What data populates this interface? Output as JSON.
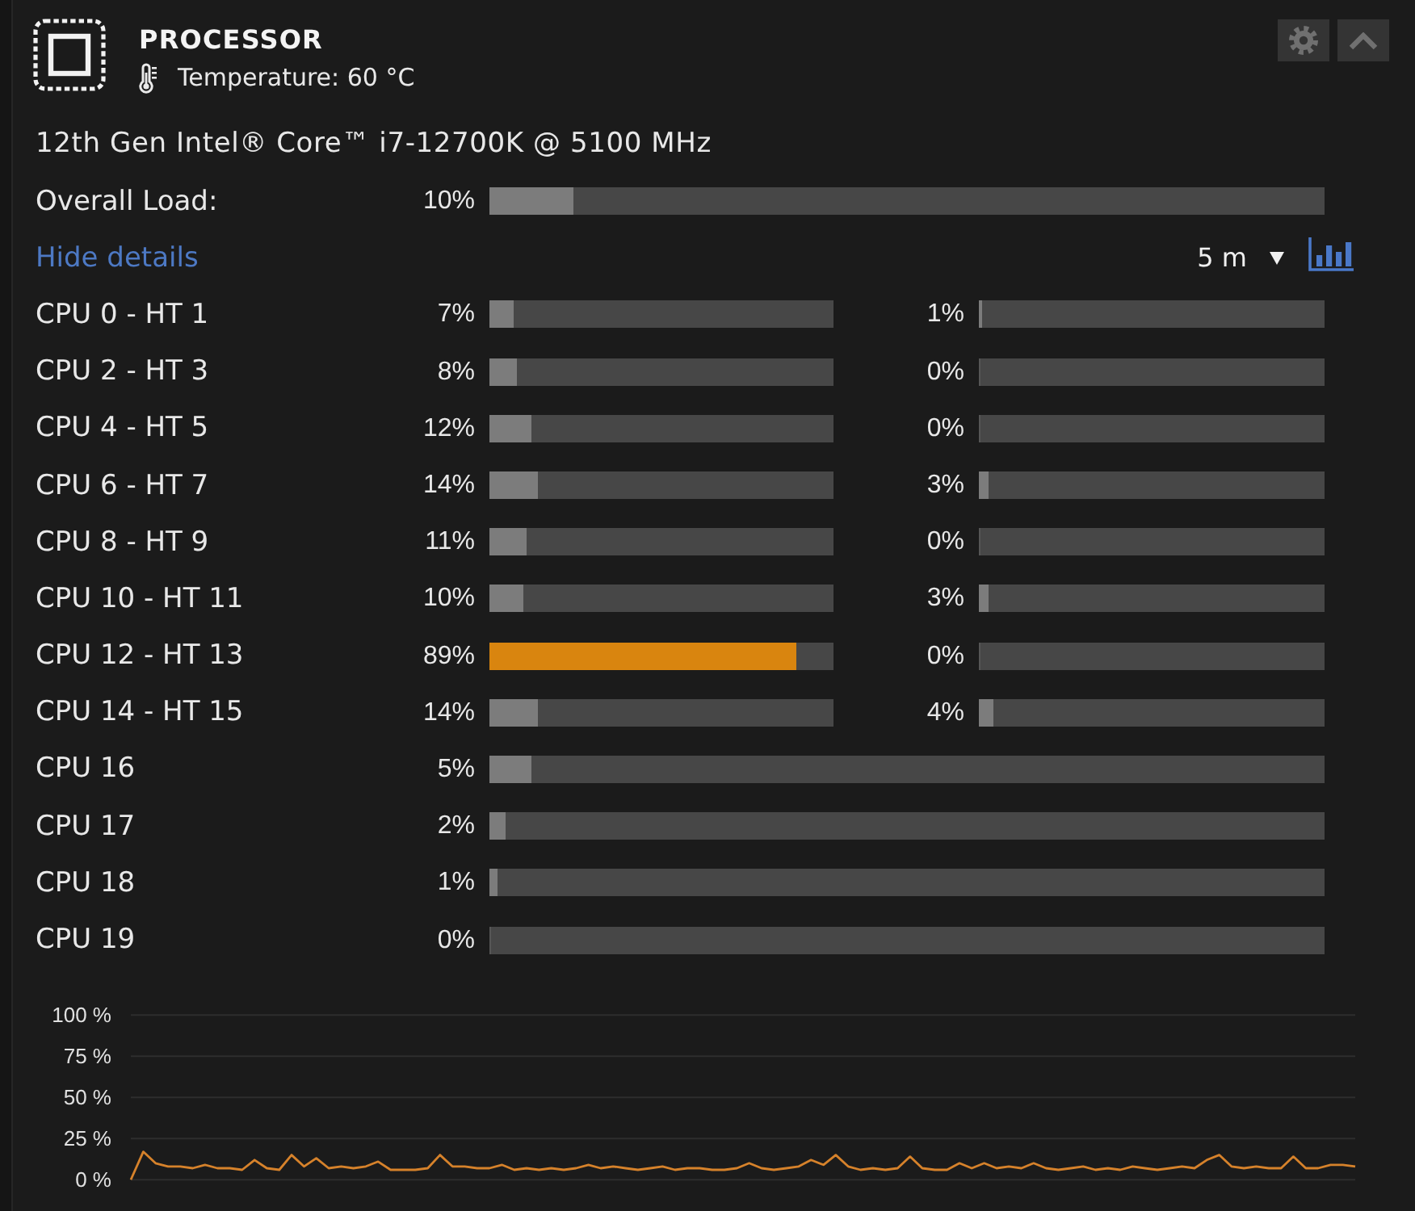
{
  "panel": {
    "title": "PROCESSOR",
    "temperature": "Temperature: 60 °C",
    "model": "12th Gen Intel® Core™ i7-12700K @ 5100 MHz"
  },
  "overall_load": {
    "label": "Overall Load:",
    "reading": "10%",
    "level": 0.1
  },
  "details_link": "Hide details",
  "time_range": {
    "value": "5 m"
  },
  "cores": [
    {
      "kind": "pair",
      "label": "CPU 0 - HT 1",
      "threads": [
        {
          "reading": "7%",
          "level": 0.07
        },
        {
          "reading": "1%",
          "level": 0.01
        }
      ]
    },
    {
      "kind": "pair",
      "label": "CPU 2 - HT 3",
      "threads": [
        {
          "reading": "8%",
          "level": 0.08
        },
        {
          "reading": "0%",
          "level": 0
        }
      ]
    },
    {
      "kind": "pair",
      "label": "CPU 4 - HT 5",
      "threads": [
        {
          "reading": "12%",
          "level": 0.12
        },
        {
          "reading": "0%",
          "level": 0
        }
      ]
    },
    {
      "kind": "pair",
      "label": "CPU 6 - HT 7",
      "threads": [
        {
          "reading": "14%",
          "level": 0.14
        },
        {
          "reading": "3%",
          "level": 0.03
        }
      ]
    },
    {
      "kind": "pair",
      "label": "CPU 8 - HT 9",
      "threads": [
        {
          "reading": "11%",
          "level": 0.11
        },
        {
          "reading": "0%",
          "level": 0
        }
      ]
    },
    {
      "kind": "pair",
      "label": "CPU 10 - HT 11",
      "threads": [
        {
          "reading": "10%",
          "level": 0.1
        },
        {
          "reading": "3%",
          "level": 0.03
        }
      ]
    },
    {
      "kind": "pair",
      "label": "CPU 12 - HT 13",
      "threads": [
        {
          "reading": "89%",
          "level": 0.89
        },
        {
          "reading": "0%",
          "level": 0
        }
      ]
    },
    {
      "kind": "pair",
      "label": "CPU 14 - HT 15",
      "threads": [
        {
          "reading": "14%",
          "level": 0.14
        },
        {
          "reading": "4%",
          "level": 0.04
        }
      ]
    },
    {
      "kind": "single",
      "label": "CPU 16",
      "threads": [
        {
          "reading": "5%",
          "level": 0.05
        }
      ]
    },
    {
      "kind": "single",
      "label": "CPU 17",
      "threads": [
        {
          "reading": "2%",
          "level": 0.02
        }
      ]
    },
    {
      "kind": "single",
      "label": "CPU 18",
      "threads": [
        {
          "reading": "1%",
          "level": 0.01
        }
      ]
    },
    {
      "kind": "single",
      "label": "CPU 19",
      "threads": [
        {
          "reading": "0%",
          "level": 0
        }
      ]
    }
  ],
  "chart": {
    "chart_data": {
      "type": "line",
      "grid": true,
      "ylim": [
        0,
        100
      ],
      "yticks": [
        {
          "value": 0,
          "label": "0 %"
        },
        {
          "value": 25,
          "label": "25 %"
        },
        {
          "value": 50,
          "label": "50 %"
        },
        {
          "value": 75,
          "label": "75 %"
        },
        {
          "value": 100,
          "label": "100 %"
        }
      ],
      "values": [
        0,
        17,
        10,
        8,
        8,
        7,
        9,
        7,
        7,
        6,
        12,
        7,
        6,
        15,
        8,
        13,
        7,
        8,
        7,
        8,
        11,
        6,
        6,
        6,
        7,
        15,
        8,
        8,
        7,
        7,
        9,
        6,
        7,
        6,
        7,
        6,
        7,
        9,
        7,
        8,
        7,
        6,
        7,
        8,
        6,
        7,
        7,
        6,
        6,
        7,
        10,
        7,
        6,
        7,
        8,
        12,
        9,
        15,
        8,
        6,
        7,
        6,
        7,
        14,
        7,
        6,
        6,
        10,
        7,
        10,
        7,
        8,
        7,
        10,
        7,
        6,
        7,
        8,
        6,
        7,
        6,
        8,
        7,
        6,
        7,
        8,
        7,
        12,
        15,
        8,
        7,
        8,
        7,
        7,
        14,
        7,
        7,
        9,
        9,
        8
      ]
    }
  }
}
